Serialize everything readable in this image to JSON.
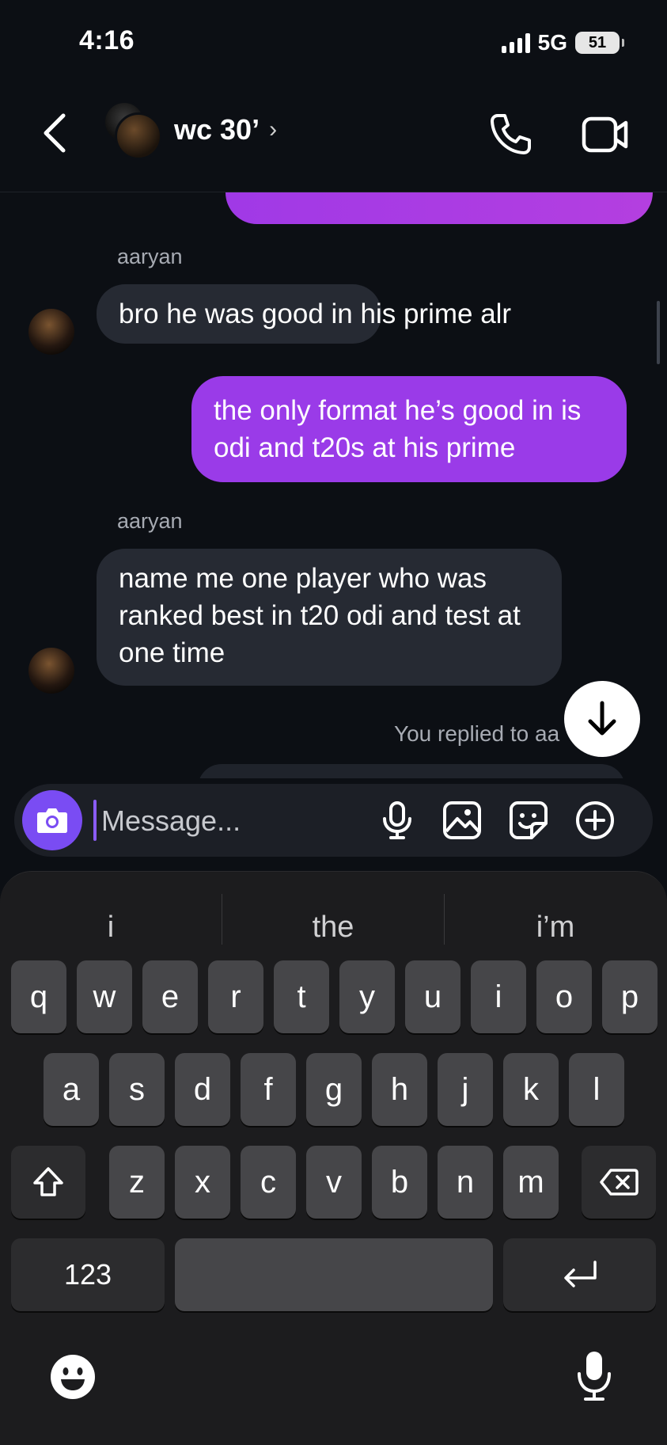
{
  "status_bar": {
    "time": "4:16",
    "network": "5G",
    "battery": "51"
  },
  "header": {
    "title": "wc 30’",
    "chevron": "›"
  },
  "messages": {
    "partial_top": "",
    "sender1": "aaryan",
    "msg1": "bro he was good in his prime alr",
    "msg2": "the only format he’s good in is odi and t20s at his prime",
    "sender2": "aaryan",
    "msg3": "name me one player who was ranked best in t20 odi and test at one time",
    "replied": "You replied to aa"
  },
  "composer": {
    "placeholder": "Message..."
  },
  "keyboard": {
    "suggestions": [
      "i",
      "the",
      "i’m"
    ],
    "row1": [
      "q",
      "w",
      "e",
      "r",
      "t",
      "y",
      "u",
      "i",
      "o",
      "p"
    ],
    "row2": [
      "a",
      "s",
      "d",
      "f",
      "g",
      "h",
      "j",
      "k",
      "l"
    ],
    "row3": [
      "z",
      "x",
      "c",
      "v",
      "b",
      "n",
      "m"
    ],
    "numbers_label": "123"
  },
  "colors": {
    "accent_purple": "#9a3be8",
    "camera_button": "#7a4cf3",
    "background": "#0c0f14"
  }
}
